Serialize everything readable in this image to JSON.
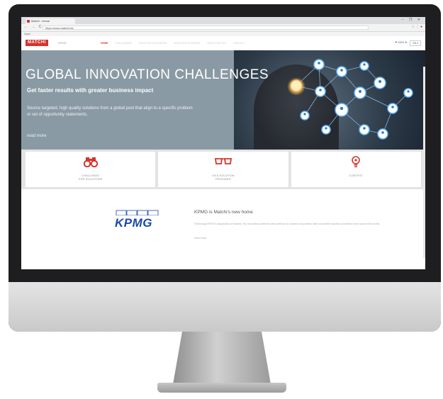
{
  "browser": {
    "tab_title": "Matchi - Home",
    "window_controls": "– ❐ ✕",
    "nav_buttons": "← → C ⌂",
    "url": "https://www.matchi.biz",
    "bookmarks": "Apps",
    "extensions": "☆ ⋮"
  },
  "site": {
    "logo": "MATCHI",
    "logo_sub": "KPMG",
    "nav": [
      {
        "label": "HOME",
        "active": true
      },
      {
        "label": "CHALLENGES"
      },
      {
        "label": "SOLUTION PROVIDERS"
      },
      {
        "label": "HOW MATCHI WORKS"
      },
      {
        "label": "ABOUT MATCHI"
      },
      {
        "label": "CONTACT"
      }
    ],
    "signin": "⚑ SIGN IN",
    "language": "EN ▾"
  },
  "hero": {
    "title": "GLOBAL INNOVATION CHALLENGES",
    "subtitle": "Get faster results with greater business impact",
    "description": "Source targeted, high quality solutions from a global pool that align to a specific problem or set of opportunity statements.",
    "link": "read more"
  },
  "cards": [
    {
      "icon": "binoculars-icon",
      "label_line1": "CHALLENGE",
      "label_line2": "FOR SOLUTIONS"
    },
    {
      "icon": "glasses-icon",
      "label_line1": "I'M A SOLUTION",
      "label_line2": "PROVIDER"
    },
    {
      "icon": "lightbulb-icon",
      "label_line1": "CONTEST",
      "label_line2": ""
    }
  ],
  "news": {
    "logo_text": "KPMG",
    "title": "KPMG is Matchi's new home",
    "body": "Following KPMG's acquisition of Matchi, the innovation platform will continue to connect corporates with innovative solution providers from around the world.",
    "more": "read more"
  },
  "colors": {
    "accent": "#d6332b",
    "hero_bg": "#8a9aa4",
    "kpmg_blue": "#1b4aa6"
  }
}
